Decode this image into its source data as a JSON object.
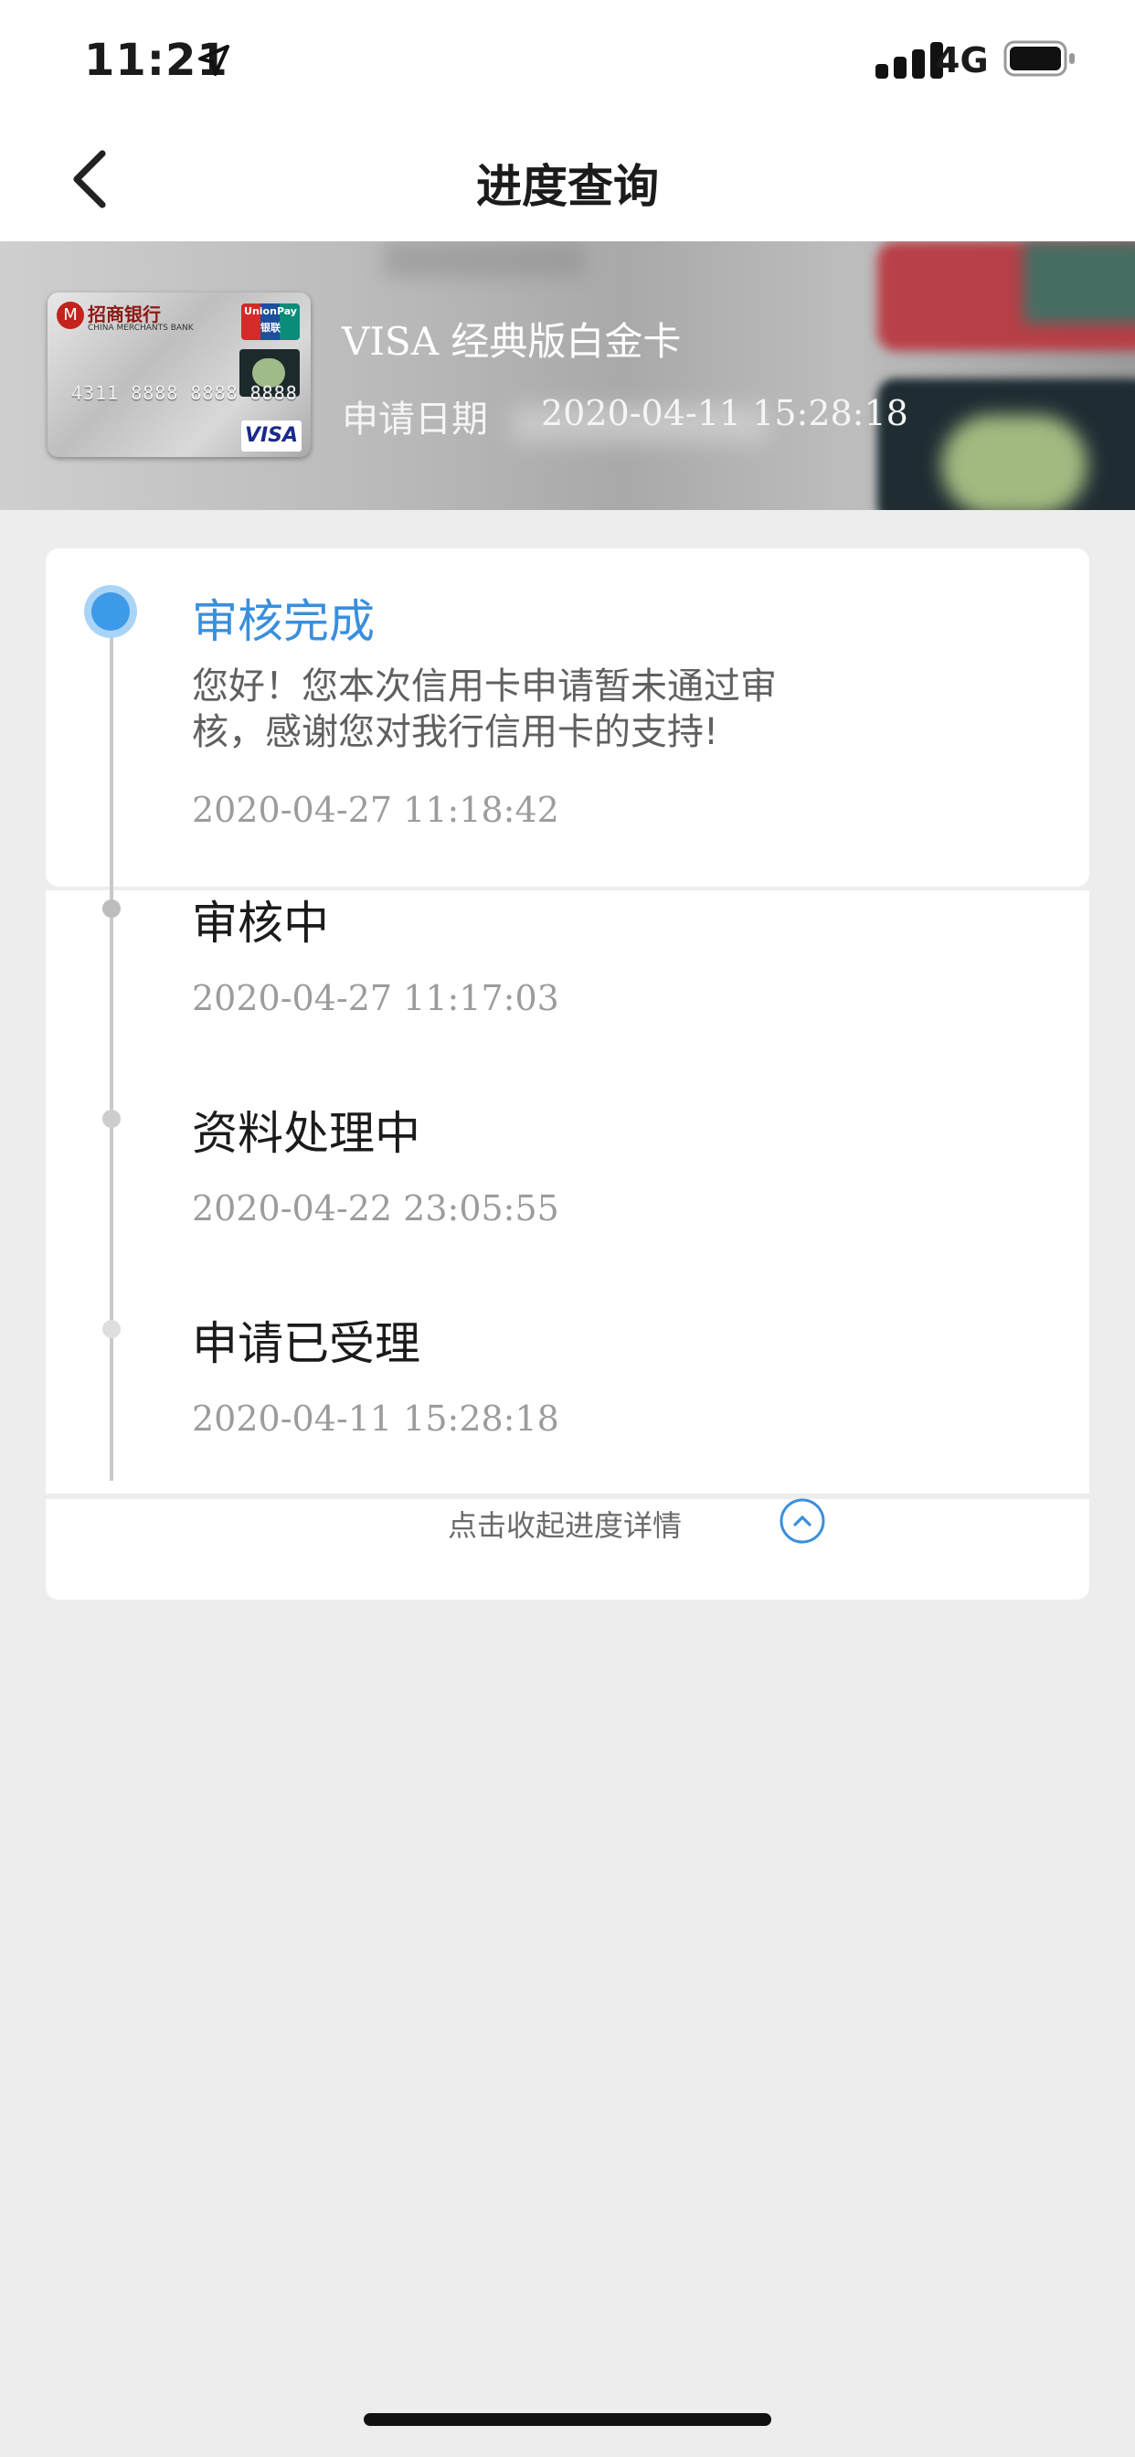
{
  "status_bar": {
    "time": "11:21",
    "network": "4G",
    "icons": [
      "location-arrow-icon",
      "signal-icon",
      "battery-icon"
    ]
  },
  "nav": {
    "title": "进度查询",
    "back_icon": "chevron-left-icon"
  },
  "card_info": {
    "card_name": "VISA 经典版白金卡",
    "apply_label": "申请日期",
    "apply_date": "2020-04-11 15:28:18",
    "card_image": {
      "bank_name": "招商银行",
      "bank_sub": "CHINA MERCHANTS BANK",
      "unionpay": "UnionPay 银联",
      "number": "4311 8888 8888 8888",
      "visa": "VISA"
    }
  },
  "timeline": [
    {
      "title": "审核完成",
      "active": true,
      "description": "您好！您本次信用卡申请暂未通过审核，感谢您对我行信用卡的支持!",
      "time": "2020-04-27 11:18:42"
    },
    {
      "title": "审核中",
      "active": false,
      "time": "2020-04-27 11:17:03"
    },
    {
      "title": "资料处理中",
      "active": false,
      "time": "2020-04-22 23:05:55"
    },
    {
      "title": "申请已受理",
      "active": false,
      "time": "2020-04-11 15:28:18"
    }
  ],
  "collapse": {
    "label": "点击收起进度详情",
    "icon": "chevron-up-circle-icon"
  },
  "colors": {
    "accent": "#3a8fdc",
    "background": "#ededed",
    "panel": "#ffffff"
  }
}
